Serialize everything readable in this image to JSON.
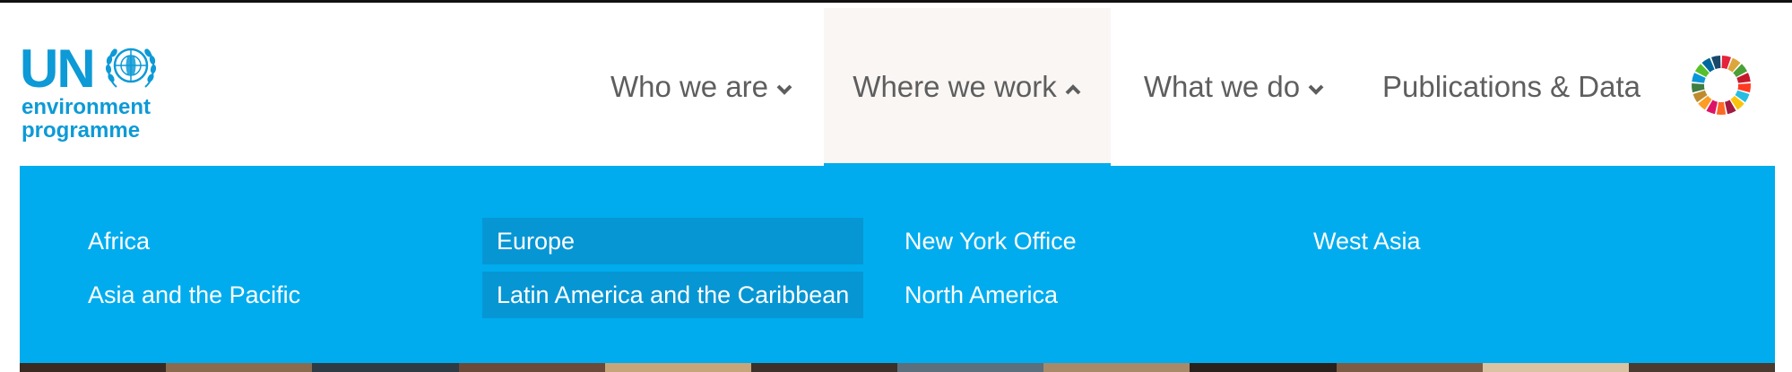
{
  "logo": {
    "un_text": "UN",
    "line1": "environment",
    "line2": "programme",
    "emblem_icon": "un-emblem-icon",
    "color": "#0d9ad6"
  },
  "nav": {
    "items": [
      {
        "label": "Who we are",
        "icon": "chevron-down-icon",
        "expanded": false
      },
      {
        "label": "Where we work",
        "icon": "chevron-up-icon",
        "expanded": true
      },
      {
        "label": "What we do",
        "icon": "chevron-down-icon",
        "expanded": false
      },
      {
        "label": "Publications & Data"
      }
    ],
    "sdg_icon": "sdg-wheel-icon"
  },
  "dropdown": {
    "background": "#00acee",
    "highlight": "#0796d4",
    "regions": [
      "Africa",
      "Asia and the Pacific",
      "Europe",
      "Latin America and the Caribbean",
      "New York Office",
      "North America",
      "West Asia"
    ]
  }
}
